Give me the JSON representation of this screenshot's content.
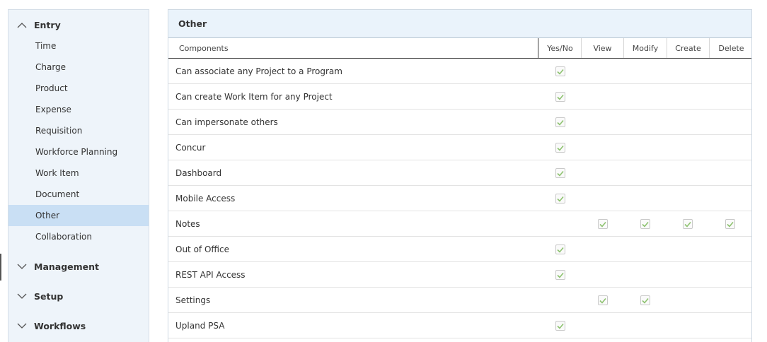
{
  "sidebar": {
    "groups": {
      "entry": "Entry",
      "management": "Management",
      "setup": "Setup",
      "workflows": "Workflows"
    },
    "items": [
      "Time",
      "Charge",
      "Product",
      "Expense",
      "Requisition",
      "Workforce Planning",
      "Work Item",
      "Document",
      "Other",
      "Collaboration"
    ],
    "active_item": "Other"
  },
  "panel": {
    "title": "Other",
    "columns": {
      "components": "Components",
      "yes_no": "Yes/No",
      "view": "View",
      "modify": "Modify",
      "create": "Create",
      "delete": "Delete"
    },
    "rows": [
      {
        "name": "Can associate any Project to a Program",
        "yes_no": true,
        "view": false,
        "modify": false,
        "create": false,
        "delete": false
      },
      {
        "name": "Can create Work Item for any Project",
        "yes_no": true,
        "view": false,
        "modify": false,
        "create": false,
        "delete": false
      },
      {
        "name": "Can impersonate others",
        "yes_no": true,
        "view": false,
        "modify": false,
        "create": false,
        "delete": false
      },
      {
        "name": "Concur",
        "yes_no": true,
        "view": false,
        "modify": false,
        "create": false,
        "delete": false
      },
      {
        "name": "Dashboard",
        "yes_no": true,
        "view": false,
        "modify": false,
        "create": false,
        "delete": false
      },
      {
        "name": "Mobile Access",
        "yes_no": true,
        "view": false,
        "modify": false,
        "create": false,
        "delete": false
      },
      {
        "name": "Notes",
        "yes_no": false,
        "view": true,
        "modify": true,
        "create": true,
        "delete": true
      },
      {
        "name": "Out of Office",
        "yes_no": true,
        "view": false,
        "modify": false,
        "create": false,
        "delete": false
      },
      {
        "name": "REST API Access",
        "yes_no": true,
        "view": false,
        "modify": false,
        "create": false,
        "delete": false
      },
      {
        "name": "Settings",
        "yes_no": false,
        "view": true,
        "modify": true,
        "create": false,
        "delete": false
      },
      {
        "name": "Upland PSA",
        "yes_no": true,
        "view": false,
        "modify": false,
        "create": false,
        "delete": false
      }
    ]
  },
  "colors": {
    "sidebar_bg": "#eef4fa",
    "active_item_bg": "#c9dff4",
    "header_bg": "#eaf3fb",
    "check_green": "#8dc26f"
  },
  "icons": {
    "expanded": "chevron-up-icon",
    "collapsed": "chevron-down-icon",
    "checked": "checkmark-icon"
  }
}
